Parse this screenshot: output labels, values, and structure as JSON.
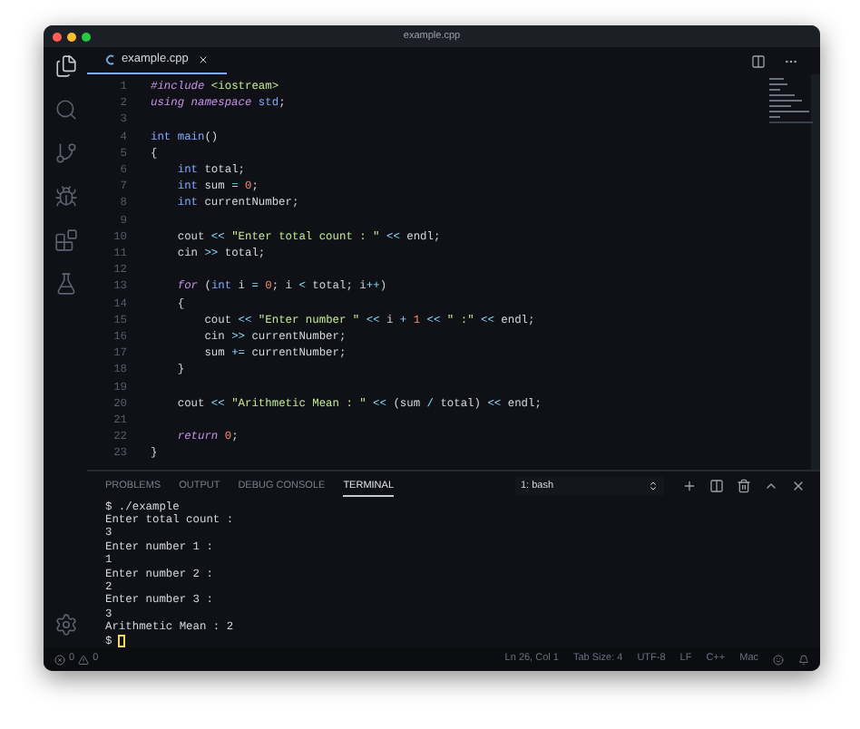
{
  "window": {
    "title": "example.cpp"
  },
  "activity_bar": {
    "items": [
      {
        "kind": "files",
        "selected": true
      },
      {
        "kind": "search",
        "selected": false
      },
      {
        "kind": "source-control",
        "selected": false
      },
      {
        "kind": "debug",
        "selected": false
      },
      {
        "kind": "extensions",
        "selected": false
      },
      {
        "kind": "flask",
        "selected": false
      }
    ]
  },
  "editor_tabs": [
    {
      "label": "example.cpp",
      "selected": true
    }
  ],
  "code": [
    {
      "number": "1",
      "tokens": [
        {
          "kind": "preproc",
          "text": "#include"
        },
        {
          "kind": "include",
          "text": " <iostream>"
        }
      ]
    },
    {
      "number": "2",
      "tokens": [
        {
          "kind": "keyword",
          "text": "using namespace"
        },
        {
          "kind": "type",
          "text": " std"
        },
        {
          "kind": "plain",
          "text": ";"
        }
      ]
    },
    {
      "number": "3"
    },
    {
      "number": "4",
      "tokens": [
        {
          "kind": "type",
          "text": "int"
        },
        {
          "kind": "func",
          "text": " main"
        },
        {
          "kind": "plain",
          "text": "()"
        }
      ]
    },
    {
      "number": "5",
      "tokens": [
        {
          "kind": "plain",
          "text": "{"
        }
      ]
    },
    {
      "number": "6",
      "tokens": [
        {
          "kind": "type",
          "text": "    int"
        },
        {
          "kind": "plain",
          "text": " total;"
        }
      ]
    },
    {
      "number": "7",
      "tokens": [
        {
          "kind": "type",
          "text": "    int"
        },
        {
          "kind": "plain",
          "text": " sum "
        },
        {
          "kind": "op",
          "text": "="
        },
        {
          "kind": "number",
          "text": " 0"
        },
        {
          "kind": "plain",
          "text": ";"
        }
      ]
    },
    {
      "number": "8",
      "tokens": [
        {
          "kind": "type",
          "text": "    int"
        },
        {
          "kind": "plain",
          "text": " currentNumber;"
        }
      ]
    },
    {
      "number": "9"
    },
    {
      "number": "10",
      "tokens": [
        {
          "kind": "plain",
          "text": "    cout "
        },
        {
          "kind": "op",
          "text": "<<"
        },
        {
          "kind": "string",
          "text": " \"Enter total count : \""
        },
        {
          "kind": "op",
          "text": " <<"
        },
        {
          "kind": "plain",
          "text": " endl;"
        }
      ]
    },
    {
      "number": "11",
      "tokens": [
        {
          "kind": "plain",
          "text": "    cin "
        },
        {
          "kind": "op",
          "text": ">>"
        },
        {
          "kind": "plain",
          "text": " total;"
        }
      ]
    },
    {
      "number": "12"
    },
    {
      "number": "13",
      "tokens": [
        {
          "kind": "keyword",
          "text": "    for"
        },
        {
          "kind": "plain",
          "text": " ("
        },
        {
          "kind": "type",
          "text": "int"
        },
        {
          "kind": "plain",
          "text": " i "
        },
        {
          "kind": "op",
          "text": "="
        },
        {
          "kind": "number",
          "text": " 0"
        },
        {
          "kind": "plain",
          "text": "; i "
        },
        {
          "kind": "op",
          "text": "<"
        },
        {
          "kind": "plain",
          "text": " total; i"
        },
        {
          "kind": "op",
          "text": "++"
        },
        {
          "kind": "plain",
          "text": ")"
        }
      ]
    },
    {
      "number": "14",
      "tokens": [
        {
          "kind": "plain",
          "text": "    {"
        }
      ]
    },
    {
      "number": "15",
      "tokens": [
        {
          "kind": "plain",
          "text": "        cout "
        },
        {
          "kind": "op",
          "text": "<<"
        },
        {
          "kind": "string",
          "text": " \"Enter number \""
        },
        {
          "kind": "op",
          "text": " <<"
        },
        {
          "kind": "plain",
          "text": " i "
        },
        {
          "kind": "op",
          "text": "+"
        },
        {
          "kind": "number",
          "text": " 1"
        },
        {
          "kind": "op",
          "text": " <<"
        },
        {
          "kind": "string",
          "text": " \" :\""
        },
        {
          "kind": "op",
          "text": " <<"
        },
        {
          "kind": "plain",
          "text": " endl;"
        }
      ]
    },
    {
      "number": "16",
      "tokens": [
        {
          "kind": "plain",
          "text": "        cin "
        },
        {
          "kind": "op",
          "text": ">>"
        },
        {
          "kind": "plain",
          "text": " currentNumber;"
        }
      ]
    },
    {
      "number": "17",
      "tokens": [
        {
          "kind": "plain",
          "text": "        sum "
        },
        {
          "kind": "op",
          "text": "+="
        },
        {
          "kind": "plain",
          "text": " currentNumber;"
        }
      ]
    },
    {
      "number": "18",
      "tokens": [
        {
          "kind": "plain",
          "text": "    }"
        }
      ]
    },
    {
      "number": "19"
    },
    {
      "number": "20",
      "tokens": [
        {
          "kind": "plain",
          "text": "    cout "
        },
        {
          "kind": "op",
          "text": "<<"
        },
        {
          "kind": "string",
          "text": " \"Arithmetic Mean : \""
        },
        {
          "kind": "op",
          "text": " <<"
        },
        {
          "kind": "plain",
          "text": " (sum "
        },
        {
          "kind": "op",
          "text": "/"
        },
        {
          "kind": "plain",
          "text": " total) "
        },
        {
          "kind": "op",
          "text": "<<"
        },
        {
          "kind": "plain",
          "text": " endl;"
        }
      ]
    },
    {
      "number": "21"
    },
    {
      "number": "22",
      "tokens": [
        {
          "kind": "keyword",
          "text": "    return"
        },
        {
          "kind": "number",
          "text": " 0"
        },
        {
          "kind": "plain",
          "text": ";"
        }
      ]
    },
    {
      "number": "23",
      "tokens": [
        {
          "kind": "plain",
          "text": "}"
        }
      ]
    }
  ],
  "panel": {
    "tabs": [
      {
        "label": "PROBLEMS",
        "selected": false
      },
      {
        "label": "OUTPUT",
        "selected": false
      },
      {
        "label": "DEBUG CONSOLE",
        "selected": false
      },
      {
        "label": "TERMINAL",
        "selected": true
      }
    ],
    "terminal_select": "1: bash",
    "terminal_lines": [
      "$ ./example",
      "Enter total count :",
      "3",
      "Enter number 1 :",
      "1",
      "Enter number 2 :",
      "2",
      "Enter number 3 :",
      "3",
      "Arithmetic Mean : 2"
    ],
    "prompt": "$"
  },
  "status_bar": {
    "errors": "0",
    "warnings": "0",
    "items": [
      "Ln 26, Col 1",
      "Tab Size: 4",
      "UTF-8",
      "LF",
      "C++",
      "Mac"
    ]
  }
}
